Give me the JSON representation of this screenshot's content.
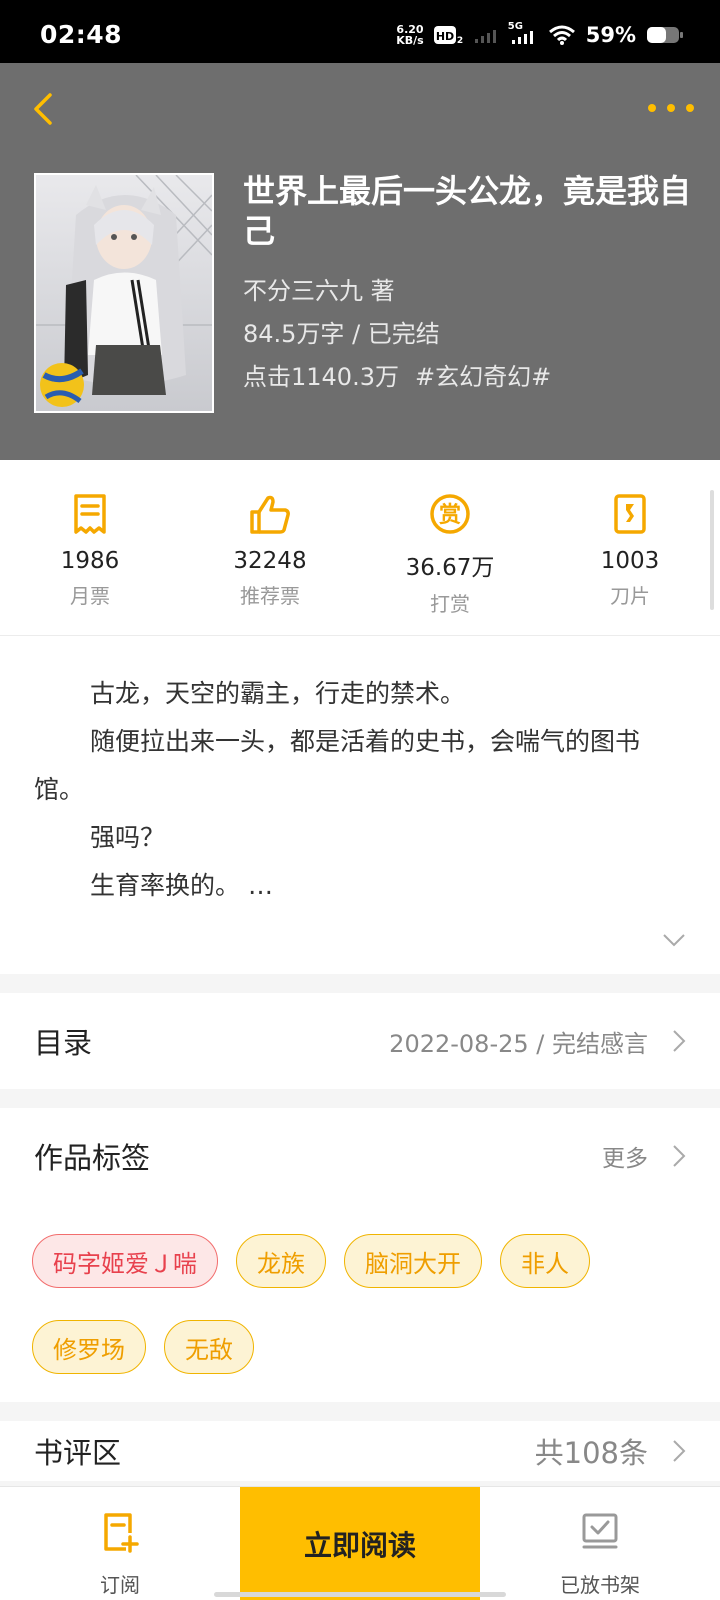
{
  "status_bar": {
    "time": "02:48",
    "net_speed_value": "6.20",
    "net_speed_unit": "KB/s",
    "network_label": "5G",
    "battery": "59%"
  },
  "book": {
    "title": "世界上最后一头公龙，竟是我自己",
    "author": "不分三六九  著",
    "words_status": "84.5万字 / 已完结",
    "clicks": "点击1140.3万",
    "genre_tag": "#玄幻奇幻#"
  },
  "stats": [
    {
      "value": "1986",
      "label": "月票",
      "icon": "ticket-icon"
    },
    {
      "value": "32248",
      "label": "推荐票",
      "icon": "thumbs-up-icon"
    },
    {
      "value": "36.67万",
      "label": "打赏",
      "icon": "reward-icon"
    },
    {
      "value": "1003",
      "label": "刀片",
      "icon": "blade-icon"
    }
  ],
  "intro": {
    "lines": [
      "古龙，天空的霸主，行走的禁术。",
      "随便拉出来一头，都是活着的史书，会喘气的图书馆。",
      "强吗？",
      "生育率换的。 …"
    ]
  },
  "toc": {
    "label": "目录",
    "latest": "2022-08-25 / 完结感言"
  },
  "tags": {
    "label": "作品标签",
    "more": "更多",
    "items": [
      "码字姬爱Ｊ喘",
      "龙族",
      "脑洞大开",
      "非人",
      "修罗场",
      "无敌"
    ]
  },
  "reviews": {
    "label": "书评区",
    "count": "共108条"
  },
  "bottom_bar": {
    "subscribe": "订阅",
    "read_now": "立即阅读",
    "on_shelf": "已放书架"
  },
  "colors": {
    "accent": "#ffbe00",
    "header_bg": "#6e6e6e",
    "icon_orange": "#f5a800",
    "tag_red": "#e8414d"
  }
}
